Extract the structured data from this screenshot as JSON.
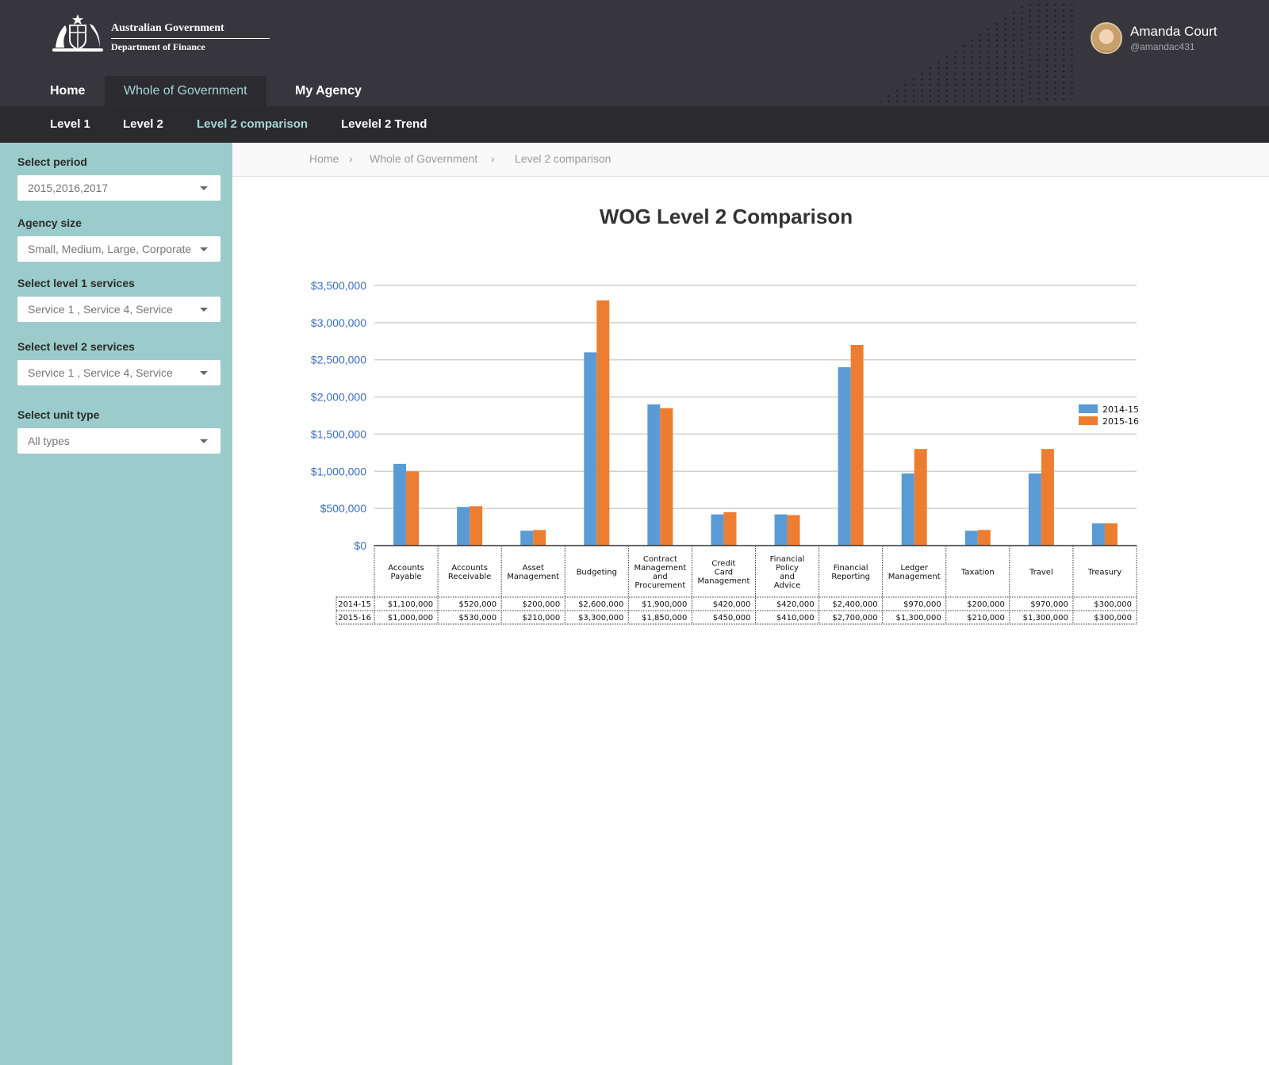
{
  "header": {
    "org_line1": "Australian Government",
    "org_line2": "Department of Finance",
    "user_name": "Amanda Court",
    "user_handle": "@amandac431"
  },
  "main_nav": [
    {
      "label": "Home",
      "active": false
    },
    {
      "label": "Whole of Government",
      "active": true
    },
    {
      "label": "My Agency",
      "active": false
    }
  ],
  "sub_nav": [
    {
      "label": "Level 1",
      "active": false
    },
    {
      "label": "Level 2",
      "active": false
    },
    {
      "label": "Level 2 comparison",
      "active": true
    },
    {
      "label": "Levelel 2 Trend",
      "active": false
    }
  ],
  "filters": {
    "period": {
      "label": "Select period",
      "value": "2015,2016,2017"
    },
    "agency_size": {
      "label": "Agency size",
      "value": "Small, Medium, Large, Corporate"
    },
    "level1": {
      "label": "Select level 1 services",
      "value": "Service 1 , Service 4, Service"
    },
    "level2": {
      "label": "Select level 2 services",
      "value": "Service 1 , Service 4, Service"
    },
    "unit_type": {
      "label": "Select unit type",
      "value": "All types"
    }
  },
  "breadcrumb": [
    "Home",
    "Whole of Government",
    "Level 2 comparison"
  ],
  "colors": {
    "series_2014": "#5b9bd5",
    "series_2015": "#ed7d31",
    "header_bg": "#37363c",
    "sidebar_bg": "#9ccbcb",
    "accent": "#a6d6d6"
  },
  "chart_data": {
    "type": "bar",
    "title": "WOG Level 2 Comparison",
    "categories": [
      "Accounts Payable",
      "Accounts Receivable",
      "Asset Management",
      "Budgeting",
      "Contract Management and Procurement",
      "Credit Card Management",
      "Financial Policy and Advice",
      "Financial Reporting",
      "Ledger Management",
      "Taxation",
      "Travel",
      "Treasury"
    ],
    "series": [
      {
        "name": "2014-15",
        "values": [
          1100000,
          520000,
          200000,
          2600000,
          1900000,
          420000,
          420000,
          2400000,
          970000,
          200000,
          970000,
          300000
        ],
        "labels": [
          "$1,100,000",
          "$520,000",
          "$200,000",
          "$2,600,000",
          "$1,900,000",
          "$420,000",
          "$420,000",
          "$2,400,000",
          "$970,000",
          "$200,000",
          "$970,000",
          "$300,000"
        ]
      },
      {
        "name": "2015-16",
        "values": [
          1000000,
          530000,
          210000,
          3300000,
          1850000,
          450000,
          410000,
          2700000,
          1300000,
          210000,
          1300000,
          300000
        ],
        "labels": [
          "$1,000,000",
          "$530,000",
          "$210,000",
          "$3,300,000",
          "$1,850,000",
          "$450,000",
          "$410,000",
          "$2,700,000",
          "$1,300,000",
          "$210,000",
          "$1,300,000",
          "$300,000"
        ]
      }
    ],
    "y_ticks": [
      "$0",
      "$500,000",
      "$1,000,000",
      "$1,500,000",
      "$2,000,000",
      "$2,500,000",
      "$3,000,000",
      "$3,500,000"
    ],
    "ylim": [
      0,
      3500000
    ],
    "grid": true,
    "legend": "right",
    "data_table": true
  }
}
